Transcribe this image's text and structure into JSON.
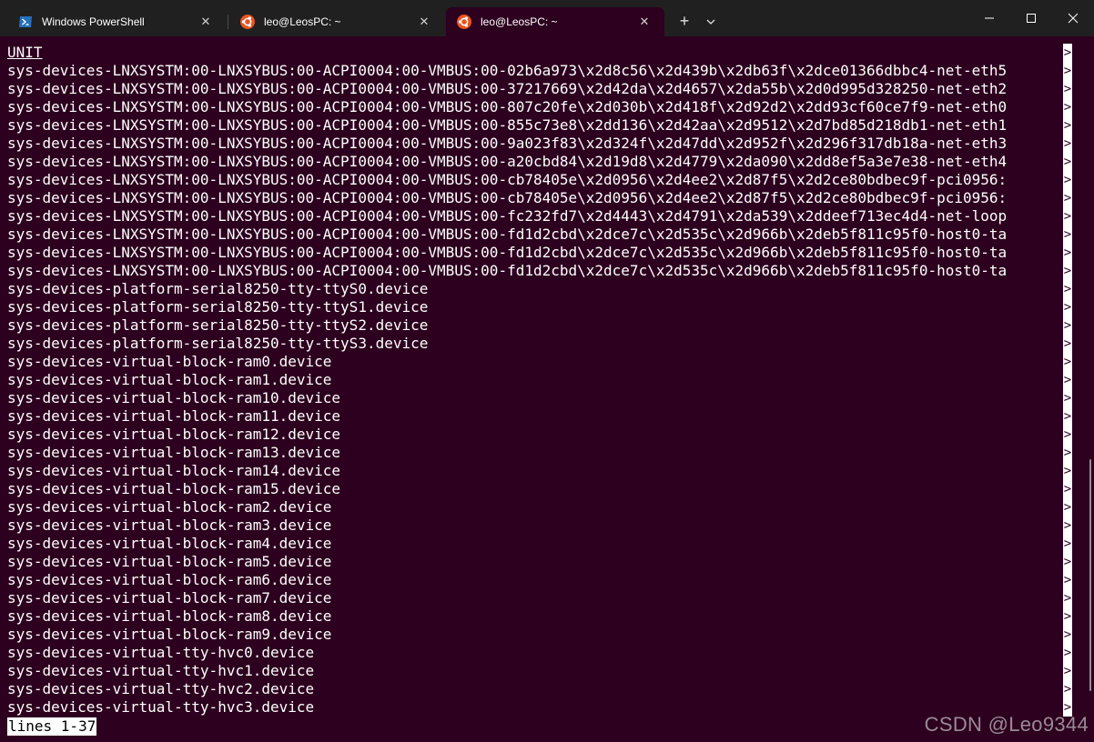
{
  "tabs": [
    {
      "title": "Windows PowerShell",
      "icon": "powershell-icon",
      "active": false
    },
    {
      "title": "leo@LeosPC: ~",
      "icon": "ubuntu-icon",
      "active": false
    },
    {
      "title": "leo@LeosPC: ~",
      "icon": "ubuntu-icon",
      "active": true
    }
  ],
  "tab_close_glyph": "✕",
  "newtab_glyph": "+",
  "colors": {
    "terminal_bg": "#2c001e",
    "titlebar_bg": "#202020",
    "ubuntu_orange": "#e95420",
    "powershell_blue": "#2671be"
  },
  "terminal": {
    "header": "UNIT",
    "trunc_marker": ">",
    "lines": [
      "sys-devices-LNXSYSTM:00-LNXSYBUS:00-ACPI0004:00-VMBUS:00-02b6a973\\x2d8c56\\x2d439b\\x2db63f\\x2dce01366dbbc4-net-eth5",
      "sys-devices-LNXSYSTM:00-LNXSYBUS:00-ACPI0004:00-VMBUS:00-37217669\\x2d42da\\x2d4657\\x2da55b\\x2d0d995d328250-net-eth2",
      "sys-devices-LNXSYSTM:00-LNXSYBUS:00-ACPI0004:00-VMBUS:00-807c20fe\\x2d030b\\x2d418f\\x2d92d2\\x2dd93cf60ce7f9-net-eth0",
      "sys-devices-LNXSYSTM:00-LNXSYBUS:00-ACPI0004:00-VMBUS:00-855c73e8\\x2dd136\\x2d42aa\\x2d9512\\x2d7bd85d218db1-net-eth1",
      "sys-devices-LNXSYSTM:00-LNXSYBUS:00-ACPI0004:00-VMBUS:00-9a023f83\\x2d324f\\x2d47dd\\x2d952f\\x2d296f317db18a-net-eth3",
      "sys-devices-LNXSYSTM:00-LNXSYBUS:00-ACPI0004:00-VMBUS:00-a20cbd84\\x2d19d8\\x2d4779\\x2da090\\x2dd8ef5a3e7e38-net-eth4",
      "sys-devices-LNXSYSTM:00-LNXSYBUS:00-ACPI0004:00-VMBUS:00-cb78405e\\x2d0956\\x2d4ee2\\x2d87f5\\x2d2ce80bdbec9f-pci0956:",
      "sys-devices-LNXSYSTM:00-LNXSYBUS:00-ACPI0004:00-VMBUS:00-cb78405e\\x2d0956\\x2d4ee2\\x2d87f5\\x2d2ce80bdbec9f-pci0956:",
      "sys-devices-LNXSYSTM:00-LNXSYBUS:00-ACPI0004:00-VMBUS:00-fc232fd7\\x2d4443\\x2d4791\\x2da539\\x2ddeef713ec4d4-net-loop",
      "sys-devices-LNXSYSTM:00-LNXSYBUS:00-ACPI0004:00-VMBUS:00-fd1d2cbd\\x2dce7c\\x2d535c\\x2d966b\\x2deb5f811c95f0-host0-ta",
      "sys-devices-LNXSYSTM:00-LNXSYBUS:00-ACPI0004:00-VMBUS:00-fd1d2cbd\\x2dce7c\\x2d535c\\x2d966b\\x2deb5f811c95f0-host0-ta",
      "sys-devices-LNXSYSTM:00-LNXSYBUS:00-ACPI0004:00-VMBUS:00-fd1d2cbd\\x2dce7c\\x2d535c\\x2d966b\\x2deb5f811c95f0-host0-ta",
      "sys-devices-platform-serial8250-tty-ttyS0.device",
      "sys-devices-platform-serial8250-tty-ttyS1.device",
      "sys-devices-platform-serial8250-tty-ttyS2.device",
      "sys-devices-platform-serial8250-tty-ttyS3.device",
      "sys-devices-virtual-block-ram0.device",
      "sys-devices-virtual-block-ram1.device",
      "sys-devices-virtual-block-ram10.device",
      "sys-devices-virtual-block-ram11.device",
      "sys-devices-virtual-block-ram12.device",
      "sys-devices-virtual-block-ram13.device",
      "sys-devices-virtual-block-ram14.device",
      "sys-devices-virtual-block-ram15.device",
      "sys-devices-virtual-block-ram2.device",
      "sys-devices-virtual-block-ram3.device",
      "sys-devices-virtual-block-ram4.device",
      "sys-devices-virtual-block-ram5.device",
      "sys-devices-virtual-block-ram6.device",
      "sys-devices-virtual-block-ram7.device",
      "sys-devices-virtual-block-ram8.device",
      "sys-devices-virtual-block-ram9.device",
      "sys-devices-virtual-tty-hvc0.device",
      "sys-devices-virtual-tty-hvc1.device",
      "sys-devices-virtual-tty-hvc2.device",
      "sys-devices-virtual-tty-hvc3.device"
    ],
    "status": "lines 1-37"
  },
  "watermark": "CSDN @Leo9344"
}
